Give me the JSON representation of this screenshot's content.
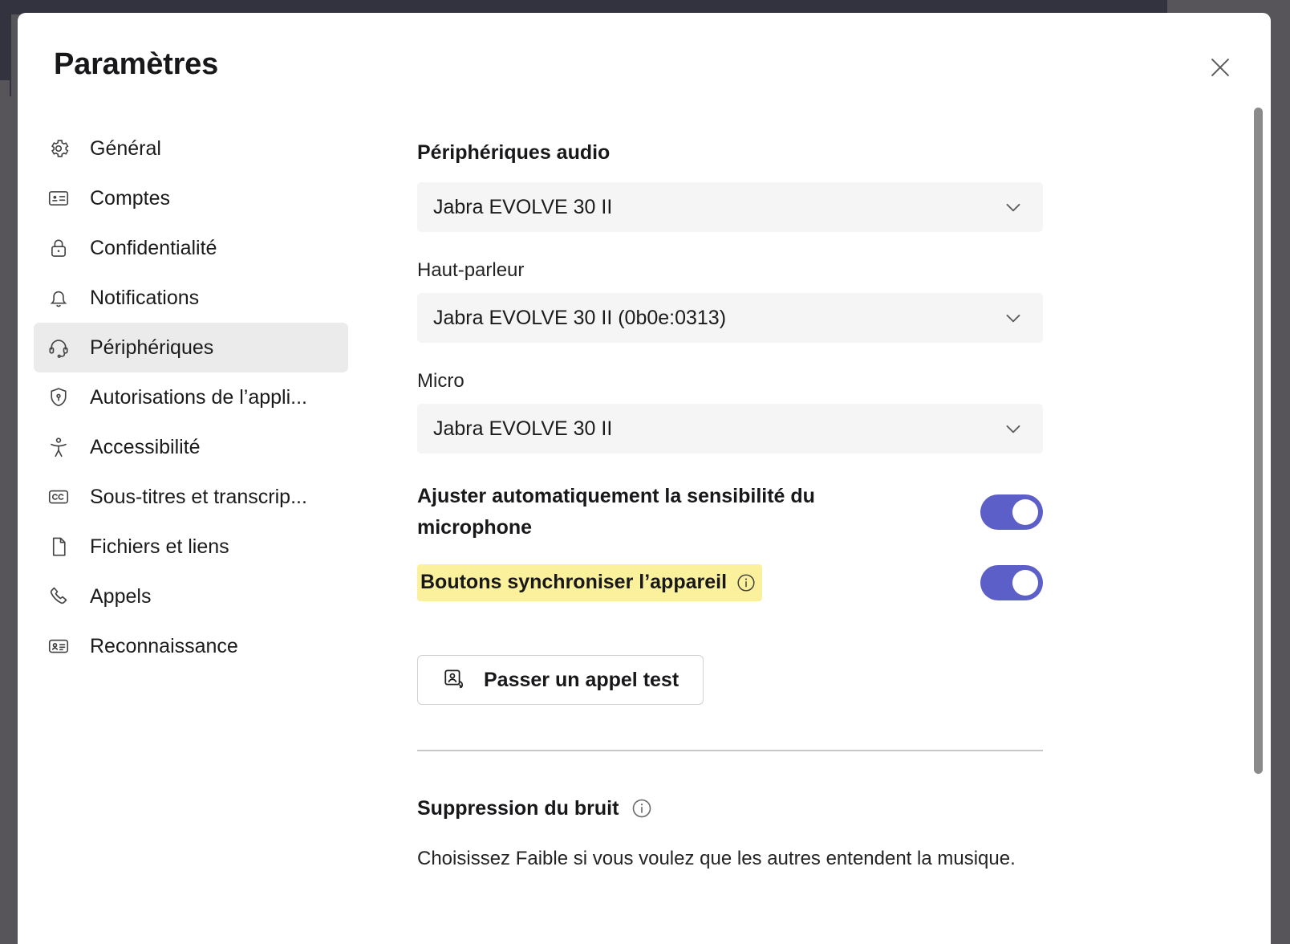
{
  "window": {
    "title": "Paramètres",
    "close_label": "×"
  },
  "sidebar": {
    "items": [
      {
        "label": "Général",
        "icon": "gear-icon",
        "selected": false
      },
      {
        "label": "Comptes",
        "icon": "id-card-icon",
        "selected": false
      },
      {
        "label": "Confidentialité",
        "icon": "lock-icon",
        "selected": false
      },
      {
        "label": "Notifications",
        "icon": "bell-icon",
        "selected": false
      },
      {
        "label": "Périphériques",
        "icon": "headset-icon",
        "selected": true
      },
      {
        "label": "Autorisations de l’appli...",
        "icon": "shield-key-icon",
        "selected": false
      },
      {
        "label": "Accessibilité",
        "icon": "accessibility-icon",
        "selected": false
      },
      {
        "label": "Sous-titres et transcrip...",
        "icon": "closed-caption-icon",
        "selected": false
      },
      {
        "label": "Fichiers et liens",
        "icon": "document-icon",
        "selected": false
      },
      {
        "label": "Appels",
        "icon": "phone-icon",
        "selected": false
      },
      {
        "label": "Reconnaissance",
        "icon": "recognition-icon",
        "selected": false
      }
    ]
  },
  "main": {
    "section_title": "Périphériques audio",
    "audio_device": {
      "value": "Jabra EVOLVE 30 II",
      "chevron": "chevron-down-icon"
    },
    "speaker": {
      "label": "Haut-parleur",
      "value": "Jabra EVOLVE 30 II (0b0e:0313)",
      "chevron": "chevron-down-icon"
    },
    "microphone": {
      "label": "Micro",
      "value": "Jabra EVOLVE 30 II",
      "chevron": "chevron-down-icon"
    },
    "auto_sensitivity": {
      "label": "Ajuster automatiquement la sensibilité du microphone",
      "state": "on"
    },
    "sync_device_buttons": {
      "label": "Boutons synchroniser l’appareil",
      "info_icon": "info-icon",
      "state": "on",
      "highlighted": true,
      "highlight_color": "#fbf19c"
    },
    "test_call": {
      "label": "Passer un appel test",
      "icon": "person-call-icon"
    },
    "noise_suppression": {
      "title": "Suppression du bruit",
      "info_icon": "info-icon",
      "description": "Choisissez Faible si vous voulez que les autres entendent la musique."
    }
  },
  "colors": {
    "accent": "#5b5fc7",
    "highlight": "#fbf19c",
    "selected_nav_bg": "#ebebeb",
    "field_bg": "#f5f5f5"
  }
}
